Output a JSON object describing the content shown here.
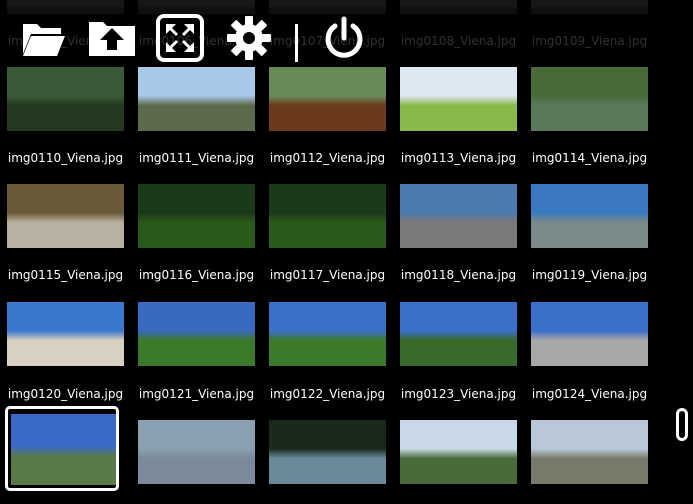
{
  "toolbar": {
    "buttons": [
      {
        "name": "open-folder-button",
        "icon": "folder-open-icon"
      },
      {
        "name": "up-directory-button",
        "icon": "arrow-up-icon"
      },
      {
        "name": "fullscreen-button",
        "icon": "fullscreen-icon"
      },
      {
        "name": "settings-button",
        "icon": "gear-icon"
      },
      {
        "name": "power-button",
        "icon": "power-icon"
      }
    ]
  },
  "gallery": {
    "top_row_partial": [
      "img0105_Viena.jpg",
      "img0106_Viena.jpg",
      "img0107_Viena.jpg",
      "img0108_Viena.jpg",
      "img0109_Viena.jpg"
    ],
    "rows": [
      [
        "img0110_Viena.jpg",
        "img0111_Viena.jpg",
        "img0112_Viena.jpg",
        "img0113_Viena.jpg",
        "img0114_Viena.jpg"
      ],
      [
        "img0115_Viena.jpg",
        "img0116_Viena.jpg",
        "img0117_Viena.jpg",
        "img0118_Viena.jpg",
        "img0119_Viena.jpg"
      ],
      [
        "img0120_Viena.jpg",
        "img0121_Viena.jpg",
        "img0122_Viena.jpg",
        "img0123_Viena.jpg",
        "img0124_Viena.jpg"
      ]
    ],
    "bottom_row_partial_count": 5,
    "selected_index": 20
  },
  "colors": {
    "background": "#000000",
    "caption_text": "#ffffff",
    "selection_border": "#ffffff",
    "faded_caption_text": "#6e6e6e"
  }
}
